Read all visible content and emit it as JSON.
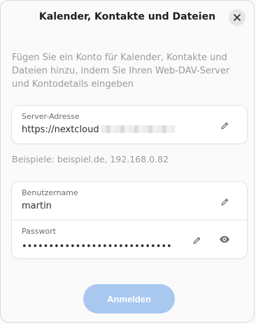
{
  "dialog": {
    "title": "Kalender, Kontakte und Dateien",
    "description": "Fügen Sie ein Konto für Kalender, Kontakte und Dateien hinzu, indem Sie Ihren Web-DAV-Server und Kontodetails eingeben"
  },
  "server": {
    "label": "Server-Adresse",
    "value": "https://nextcloud",
    "hint": "Beispiele: beispiel.de, 192.168.0.82"
  },
  "account": {
    "username_label": "Benutzername",
    "username_value": "martin",
    "password_label": "Passwort",
    "password_value": "••••••••••••••••••••••••••••"
  },
  "actions": {
    "submit_label": "Anmelden"
  },
  "colors": {
    "accent_disabled": "#a8c8f0"
  },
  "icons": [
    "close-icon",
    "edit-icon",
    "show-password-icon"
  ]
}
